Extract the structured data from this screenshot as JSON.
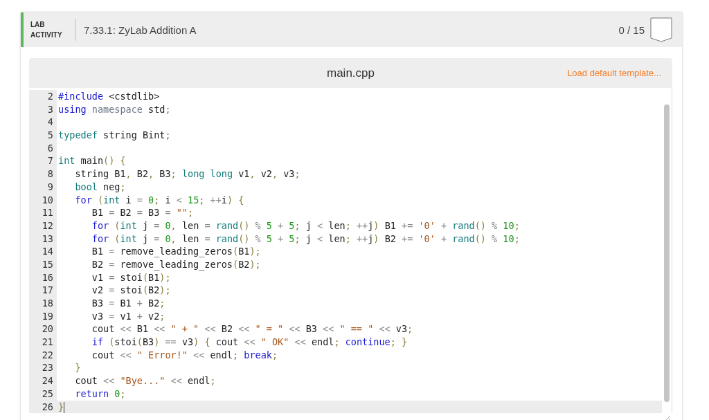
{
  "header": {
    "label": "LAB ACTIVITY",
    "title": "7.33.1: ZyLab Addition A",
    "score": "0 / 15"
  },
  "editor": {
    "filename": "main.cpp",
    "load_link": "Load default template...",
    "lines": [
      {
        "number": "2",
        "current": false,
        "tokens": [
          {
            "kind": "kw",
            "text": "#include"
          },
          {
            "kind": "pl",
            "text": " <cstdlib>"
          }
        ]
      },
      {
        "number": "3",
        "current": false,
        "tokens": [
          {
            "kind": "kw",
            "text": "using"
          },
          {
            "kind": "gr",
            "text": " namespace"
          },
          {
            "kind": "pl",
            "text": " std"
          },
          {
            "kind": "pu",
            "text": ";"
          }
        ]
      },
      {
        "number": "4",
        "current": false
      },
      {
        "number": "5",
        "current": false,
        "tokens": [
          {
            "kind": "ty",
            "text": "typedef"
          },
          {
            "kind": "pl",
            "text": " string Bint"
          },
          {
            "kind": "pu",
            "text": ";"
          }
        ]
      },
      {
        "number": "6",
        "current": false
      },
      {
        "number": "7",
        "current": false,
        "tokens": [
          {
            "kind": "ty",
            "text": "int"
          },
          {
            "kind": "pl",
            "text": " main"
          },
          {
            "kind": "pu",
            "text": "()"
          },
          {
            "kind": "pu",
            "text": " {"
          }
        ]
      },
      {
        "number": "8",
        "current": false,
        "tokens": [
          {
            "kind": "pl",
            "text": "   string B1"
          },
          {
            "kind": "pu",
            "text": ","
          },
          {
            "kind": "pl",
            "text": " B2"
          },
          {
            "kind": "pu",
            "text": ","
          },
          {
            "kind": "pl",
            "text": " B3"
          },
          {
            "kind": "pu",
            "text": ";"
          },
          {
            "kind": "ty",
            "text": " long long"
          },
          {
            "kind": "pl",
            "text": " v1"
          },
          {
            "kind": "pu",
            "text": ","
          },
          {
            "kind": "pl",
            "text": " v2"
          },
          {
            "kind": "pu",
            "text": ","
          },
          {
            "kind": "pl",
            "text": " v3"
          },
          {
            "kind": "pu",
            "text": ";"
          }
        ]
      },
      {
        "number": "9",
        "current": false,
        "tokens": [
          {
            "kind": "ty",
            "text": "   bool"
          },
          {
            "kind": "pl",
            "text": " neg"
          },
          {
            "kind": "pu",
            "text": ";"
          }
        ]
      },
      {
        "number": "10",
        "current": false,
        "tokens": [
          {
            "kind": "kw",
            "text": "   for"
          },
          {
            "kind": "pu",
            "text": " ("
          },
          {
            "kind": "ty",
            "text": "int"
          },
          {
            "kind": "pl",
            "text": " i "
          },
          {
            "kind": "op",
            "text": "="
          },
          {
            "kind": "nm",
            "text": " 0"
          },
          {
            "kind": "pu",
            "text": ";"
          },
          {
            "kind": "pl",
            "text": " i "
          },
          {
            "kind": "op",
            "text": "<"
          },
          {
            "kind": "nm",
            "text": " 15"
          },
          {
            "kind": "pu",
            "text": ";"
          },
          {
            "kind": "op",
            "text": " ++"
          },
          {
            "kind": "pl",
            "text": "i"
          },
          {
            "kind": "pu",
            "text": ")"
          },
          {
            "kind": "pu",
            "text": " {"
          }
        ]
      },
      {
        "number": "11",
        "current": false,
        "tokens": [
          {
            "kind": "pl",
            "text": "      B1 "
          },
          {
            "kind": "op",
            "text": "="
          },
          {
            "kind": "pl",
            "text": " B2 "
          },
          {
            "kind": "op",
            "text": "="
          },
          {
            "kind": "pl",
            "text": " B3 "
          },
          {
            "kind": "op",
            "text": "="
          },
          {
            "kind": "st",
            "text": " \"\""
          },
          {
            "kind": "pu",
            "text": ";"
          }
        ]
      },
      {
        "number": "12",
        "current": false,
        "tokens": [
          {
            "kind": "kw",
            "text": "      for"
          },
          {
            "kind": "pu",
            "text": " ("
          },
          {
            "kind": "ty",
            "text": "int"
          },
          {
            "kind": "pl",
            "text": " j "
          },
          {
            "kind": "op",
            "text": "="
          },
          {
            "kind": "nm",
            "text": " 0"
          },
          {
            "kind": "pu",
            "text": ","
          },
          {
            "kind": "pl",
            "text": " len "
          },
          {
            "kind": "op",
            "text": "="
          },
          {
            "kind": "ty",
            "text": " rand"
          },
          {
            "kind": "pu",
            "text": "()"
          },
          {
            "kind": "op",
            "text": " %"
          },
          {
            "kind": "nm",
            "text": " 5"
          },
          {
            "kind": "op",
            "text": " +"
          },
          {
            "kind": "nm",
            "text": " 5"
          },
          {
            "kind": "pu",
            "text": ";"
          },
          {
            "kind": "pl",
            "text": " j "
          },
          {
            "kind": "op",
            "text": "<"
          },
          {
            "kind": "pl",
            "text": " len"
          },
          {
            "kind": "pu",
            "text": ";"
          },
          {
            "kind": "op",
            "text": " ++"
          },
          {
            "kind": "pl",
            "text": "j"
          },
          {
            "kind": "pu",
            "text": ")"
          },
          {
            "kind": "pl",
            "text": " B1 "
          },
          {
            "kind": "op",
            "text": "+="
          },
          {
            "kind": "st",
            "text": " '0'"
          },
          {
            "kind": "op",
            "text": " +"
          },
          {
            "kind": "ty",
            "text": " rand"
          },
          {
            "kind": "pu",
            "text": "()"
          },
          {
            "kind": "op",
            "text": " %"
          },
          {
            "kind": "nm",
            "text": " 10"
          },
          {
            "kind": "pu",
            "text": ";"
          }
        ]
      },
      {
        "number": "13",
        "current": false,
        "tokens": [
          {
            "kind": "kw",
            "text": "      for"
          },
          {
            "kind": "pu",
            "text": " ("
          },
          {
            "kind": "ty",
            "text": "int"
          },
          {
            "kind": "pl",
            "text": " j "
          },
          {
            "kind": "op",
            "text": "="
          },
          {
            "kind": "nm",
            "text": " 0"
          },
          {
            "kind": "pu",
            "text": ","
          },
          {
            "kind": "pl",
            "text": " len "
          },
          {
            "kind": "op",
            "text": "="
          },
          {
            "kind": "ty",
            "text": " rand"
          },
          {
            "kind": "pu",
            "text": "()"
          },
          {
            "kind": "op",
            "text": " %"
          },
          {
            "kind": "nm",
            "text": " 5"
          },
          {
            "kind": "op",
            "text": " +"
          },
          {
            "kind": "nm",
            "text": " 5"
          },
          {
            "kind": "pu",
            "text": ";"
          },
          {
            "kind": "pl",
            "text": " j "
          },
          {
            "kind": "op",
            "text": "<"
          },
          {
            "kind": "pl",
            "text": " len"
          },
          {
            "kind": "pu",
            "text": ";"
          },
          {
            "kind": "op",
            "text": " ++"
          },
          {
            "kind": "pl",
            "text": "j"
          },
          {
            "kind": "pu",
            "text": ")"
          },
          {
            "kind": "pl",
            "text": " B2 "
          },
          {
            "kind": "op",
            "text": "+="
          },
          {
            "kind": "st",
            "text": " '0'"
          },
          {
            "kind": "op",
            "text": " +"
          },
          {
            "kind": "ty",
            "text": " rand"
          },
          {
            "kind": "pu",
            "text": "()"
          },
          {
            "kind": "op",
            "text": " %"
          },
          {
            "kind": "nm",
            "text": " 10"
          },
          {
            "kind": "pu",
            "text": ";"
          }
        ]
      },
      {
        "number": "14",
        "current": false,
        "tokens": [
          {
            "kind": "pl",
            "text": "      B1 "
          },
          {
            "kind": "op",
            "text": "="
          },
          {
            "kind": "pl",
            "text": " remove_leading_zeros"
          },
          {
            "kind": "pu",
            "text": "("
          },
          {
            "kind": "pl",
            "text": "B1"
          },
          {
            "kind": "pu",
            "text": ");"
          }
        ]
      },
      {
        "number": "15",
        "current": false,
        "tokens": [
          {
            "kind": "pl",
            "text": "      B2 "
          },
          {
            "kind": "op",
            "text": "="
          },
          {
            "kind": "pl",
            "text": " remove_leading_zeros"
          },
          {
            "kind": "pu",
            "text": "("
          },
          {
            "kind": "pl",
            "text": "B2"
          },
          {
            "kind": "pu",
            "text": ");"
          }
        ]
      },
      {
        "number": "16",
        "current": false,
        "tokens": [
          {
            "kind": "pl",
            "text": "      v1 "
          },
          {
            "kind": "op",
            "text": "="
          },
          {
            "kind": "pl",
            "text": " stoi"
          },
          {
            "kind": "pu",
            "text": "("
          },
          {
            "kind": "pl",
            "text": "B1"
          },
          {
            "kind": "pu",
            "text": ");"
          }
        ]
      },
      {
        "number": "17",
        "current": false,
        "tokens": [
          {
            "kind": "pl",
            "text": "      v2 "
          },
          {
            "kind": "op",
            "text": "="
          },
          {
            "kind": "pl",
            "text": " stoi"
          },
          {
            "kind": "pu",
            "text": "("
          },
          {
            "kind": "pl",
            "text": "B2"
          },
          {
            "kind": "pu",
            "text": ");"
          }
        ]
      },
      {
        "number": "18",
        "current": false,
        "tokens": [
          {
            "kind": "pl",
            "text": "      B3 "
          },
          {
            "kind": "op",
            "text": "="
          },
          {
            "kind": "pl",
            "text": " B1 "
          },
          {
            "kind": "op",
            "text": "+"
          },
          {
            "kind": "pl",
            "text": " B2"
          },
          {
            "kind": "pu",
            "text": ";"
          }
        ]
      },
      {
        "number": "19",
        "current": false,
        "tokens": [
          {
            "kind": "pl",
            "text": "      v3 "
          },
          {
            "kind": "op",
            "text": "="
          },
          {
            "kind": "pl",
            "text": " v1 "
          },
          {
            "kind": "op",
            "text": "+"
          },
          {
            "kind": "pl",
            "text": " v2"
          },
          {
            "kind": "pu",
            "text": ";"
          }
        ]
      },
      {
        "number": "20",
        "current": false,
        "tokens": [
          {
            "kind": "pl",
            "text": "      cout "
          },
          {
            "kind": "op",
            "text": "<<"
          },
          {
            "kind": "pl",
            "text": " B1 "
          },
          {
            "kind": "op",
            "text": "<<"
          },
          {
            "kind": "st",
            "text": " \" + \""
          },
          {
            "kind": "op",
            "text": " <<"
          },
          {
            "kind": "pl",
            "text": " B2 "
          },
          {
            "kind": "op",
            "text": "<<"
          },
          {
            "kind": "st",
            "text": " \" = \""
          },
          {
            "kind": "op",
            "text": " <<"
          },
          {
            "kind": "pl",
            "text": " B3 "
          },
          {
            "kind": "op",
            "text": "<<"
          },
          {
            "kind": "st",
            "text": " \" == \""
          },
          {
            "kind": "op",
            "text": " <<"
          },
          {
            "kind": "pl",
            "text": " v3"
          },
          {
            "kind": "pu",
            "text": ";"
          }
        ]
      },
      {
        "number": "21",
        "current": false,
        "tokens": [
          {
            "kind": "kw",
            "text": "      if"
          },
          {
            "kind": "pu",
            "text": " ("
          },
          {
            "kind": "pl",
            "text": "stoi"
          },
          {
            "kind": "pu",
            "text": "("
          },
          {
            "kind": "pl",
            "text": "B3"
          },
          {
            "kind": "pu",
            "text": ")"
          },
          {
            "kind": "op",
            "text": " =="
          },
          {
            "kind": "pl",
            "text": " v3"
          },
          {
            "kind": "pu",
            "text": ")"
          },
          {
            "kind": "pu",
            "text": " {"
          },
          {
            "kind": "pl",
            "text": " cout "
          },
          {
            "kind": "op",
            "text": "<<"
          },
          {
            "kind": "st",
            "text": " \" OK\""
          },
          {
            "kind": "op",
            "text": " <<"
          },
          {
            "kind": "pl",
            "text": " endl"
          },
          {
            "kind": "pu",
            "text": ";"
          },
          {
            "kind": "kw",
            "text": " continue"
          },
          {
            "kind": "pu",
            "text": ";"
          },
          {
            "kind": "pu",
            "text": " }"
          }
        ]
      },
      {
        "number": "22",
        "current": false,
        "tokens": [
          {
            "kind": "pl",
            "text": "      cout "
          },
          {
            "kind": "op",
            "text": "<<"
          },
          {
            "kind": "st",
            "text": " \" Error!\""
          },
          {
            "kind": "op",
            "text": " <<"
          },
          {
            "kind": "pl",
            "text": " endl"
          },
          {
            "kind": "pu",
            "text": ";"
          },
          {
            "kind": "kw",
            "text": " break"
          },
          {
            "kind": "pu",
            "text": ";"
          }
        ]
      },
      {
        "number": "23",
        "current": false,
        "tokens": [
          {
            "kind": "pu",
            "text": "   }"
          }
        ]
      },
      {
        "number": "24",
        "current": false,
        "tokens": [
          {
            "kind": "pl",
            "text": "   cout "
          },
          {
            "kind": "op",
            "text": "<<"
          },
          {
            "kind": "st",
            "text": " \"Bye...\""
          },
          {
            "kind": "op",
            "text": " <<"
          },
          {
            "kind": "pl",
            "text": " endl"
          },
          {
            "kind": "pu",
            "text": ";"
          }
        ]
      },
      {
        "number": "25",
        "current": false,
        "tokens": [
          {
            "kind": "kw",
            "text": "   return"
          },
          {
            "kind": "nm",
            "text": " 0"
          },
          {
            "kind": "pu",
            "text": ";"
          }
        ]
      },
      {
        "number": "26",
        "current": true,
        "tokens": [
          {
            "kind": "pu",
            "text": "}"
          }
        ]
      }
    ]
  }
}
